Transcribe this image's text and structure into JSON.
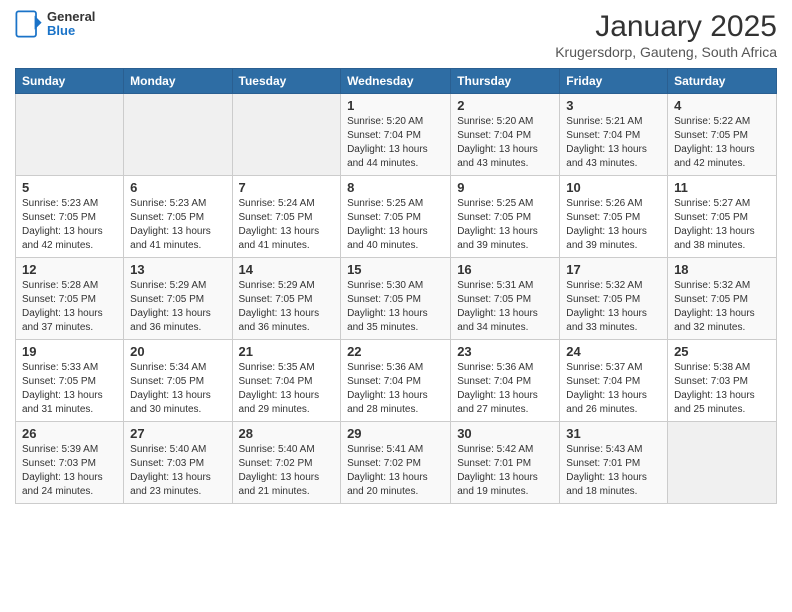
{
  "header": {
    "logo": {
      "general": "General",
      "blue": "Blue"
    },
    "title": "January 2025",
    "subtitle": "Krugersdorp, Gauteng, South Africa"
  },
  "days_of_week": [
    "Sunday",
    "Monday",
    "Tuesday",
    "Wednesday",
    "Thursday",
    "Friday",
    "Saturday"
  ],
  "weeks": [
    [
      {
        "day": "",
        "info": ""
      },
      {
        "day": "",
        "info": ""
      },
      {
        "day": "",
        "info": ""
      },
      {
        "day": "1",
        "info": "Sunrise: 5:20 AM\nSunset: 7:04 PM\nDaylight: 13 hours\nand 44 minutes."
      },
      {
        "day": "2",
        "info": "Sunrise: 5:20 AM\nSunset: 7:04 PM\nDaylight: 13 hours\nand 43 minutes."
      },
      {
        "day": "3",
        "info": "Sunrise: 5:21 AM\nSunset: 7:04 PM\nDaylight: 13 hours\nand 43 minutes."
      },
      {
        "day": "4",
        "info": "Sunrise: 5:22 AM\nSunset: 7:05 PM\nDaylight: 13 hours\nand 42 minutes."
      }
    ],
    [
      {
        "day": "5",
        "info": "Sunrise: 5:23 AM\nSunset: 7:05 PM\nDaylight: 13 hours\nand 42 minutes."
      },
      {
        "day": "6",
        "info": "Sunrise: 5:23 AM\nSunset: 7:05 PM\nDaylight: 13 hours\nand 41 minutes."
      },
      {
        "day": "7",
        "info": "Sunrise: 5:24 AM\nSunset: 7:05 PM\nDaylight: 13 hours\nand 41 minutes."
      },
      {
        "day": "8",
        "info": "Sunrise: 5:25 AM\nSunset: 7:05 PM\nDaylight: 13 hours\nand 40 minutes."
      },
      {
        "day": "9",
        "info": "Sunrise: 5:25 AM\nSunset: 7:05 PM\nDaylight: 13 hours\nand 39 minutes."
      },
      {
        "day": "10",
        "info": "Sunrise: 5:26 AM\nSunset: 7:05 PM\nDaylight: 13 hours\nand 39 minutes."
      },
      {
        "day": "11",
        "info": "Sunrise: 5:27 AM\nSunset: 7:05 PM\nDaylight: 13 hours\nand 38 minutes."
      }
    ],
    [
      {
        "day": "12",
        "info": "Sunrise: 5:28 AM\nSunset: 7:05 PM\nDaylight: 13 hours\nand 37 minutes."
      },
      {
        "day": "13",
        "info": "Sunrise: 5:29 AM\nSunset: 7:05 PM\nDaylight: 13 hours\nand 36 minutes."
      },
      {
        "day": "14",
        "info": "Sunrise: 5:29 AM\nSunset: 7:05 PM\nDaylight: 13 hours\nand 36 minutes."
      },
      {
        "day": "15",
        "info": "Sunrise: 5:30 AM\nSunset: 7:05 PM\nDaylight: 13 hours\nand 35 minutes."
      },
      {
        "day": "16",
        "info": "Sunrise: 5:31 AM\nSunset: 7:05 PM\nDaylight: 13 hours\nand 34 minutes."
      },
      {
        "day": "17",
        "info": "Sunrise: 5:32 AM\nSunset: 7:05 PM\nDaylight: 13 hours\nand 33 minutes."
      },
      {
        "day": "18",
        "info": "Sunrise: 5:32 AM\nSunset: 7:05 PM\nDaylight: 13 hours\nand 32 minutes."
      }
    ],
    [
      {
        "day": "19",
        "info": "Sunrise: 5:33 AM\nSunset: 7:05 PM\nDaylight: 13 hours\nand 31 minutes."
      },
      {
        "day": "20",
        "info": "Sunrise: 5:34 AM\nSunset: 7:05 PM\nDaylight: 13 hours\nand 30 minutes."
      },
      {
        "day": "21",
        "info": "Sunrise: 5:35 AM\nSunset: 7:04 PM\nDaylight: 13 hours\nand 29 minutes."
      },
      {
        "day": "22",
        "info": "Sunrise: 5:36 AM\nSunset: 7:04 PM\nDaylight: 13 hours\nand 28 minutes."
      },
      {
        "day": "23",
        "info": "Sunrise: 5:36 AM\nSunset: 7:04 PM\nDaylight: 13 hours\nand 27 minutes."
      },
      {
        "day": "24",
        "info": "Sunrise: 5:37 AM\nSunset: 7:04 PM\nDaylight: 13 hours\nand 26 minutes."
      },
      {
        "day": "25",
        "info": "Sunrise: 5:38 AM\nSunset: 7:03 PM\nDaylight: 13 hours\nand 25 minutes."
      }
    ],
    [
      {
        "day": "26",
        "info": "Sunrise: 5:39 AM\nSunset: 7:03 PM\nDaylight: 13 hours\nand 24 minutes."
      },
      {
        "day": "27",
        "info": "Sunrise: 5:40 AM\nSunset: 7:03 PM\nDaylight: 13 hours\nand 23 minutes."
      },
      {
        "day": "28",
        "info": "Sunrise: 5:40 AM\nSunset: 7:02 PM\nDaylight: 13 hours\nand 21 minutes."
      },
      {
        "day": "29",
        "info": "Sunrise: 5:41 AM\nSunset: 7:02 PM\nDaylight: 13 hours\nand 20 minutes."
      },
      {
        "day": "30",
        "info": "Sunrise: 5:42 AM\nSunset: 7:01 PM\nDaylight: 13 hours\nand 19 minutes."
      },
      {
        "day": "31",
        "info": "Sunrise: 5:43 AM\nSunset: 7:01 PM\nDaylight: 13 hours\nand 18 minutes."
      },
      {
        "day": "",
        "info": ""
      }
    ]
  ]
}
